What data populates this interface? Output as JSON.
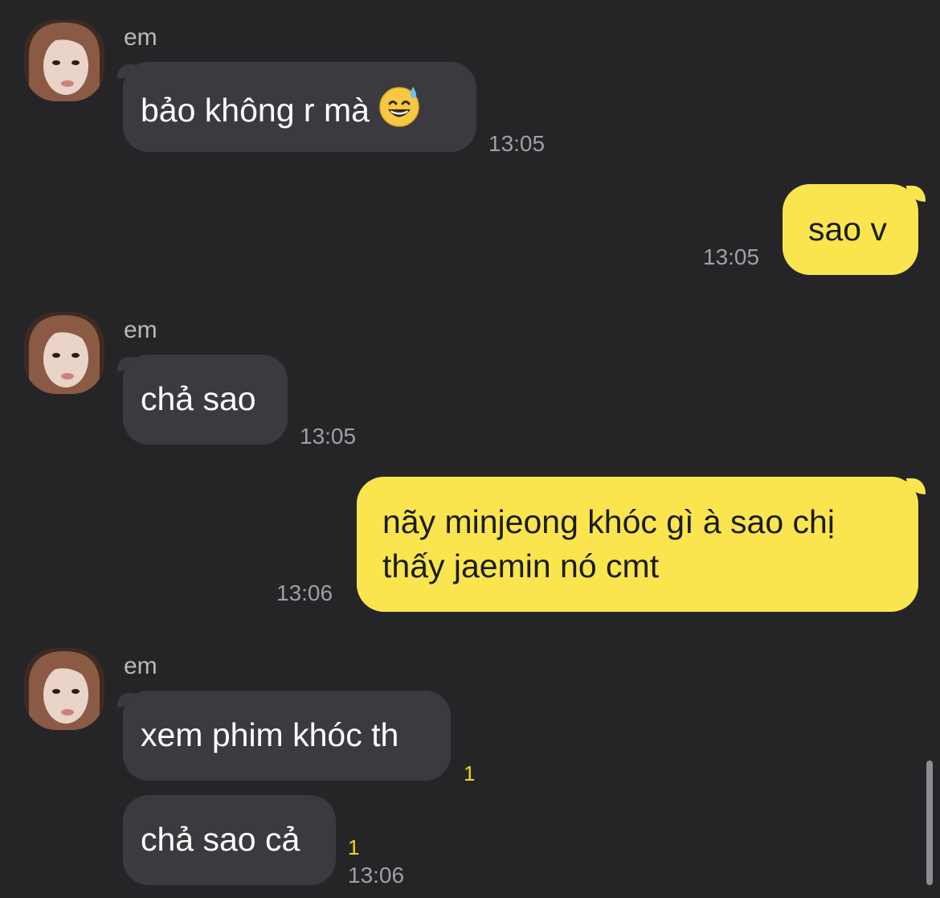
{
  "sender_name": "em",
  "messages": [
    {
      "side": "in",
      "text": "bảo không r mà",
      "emoji": "grinning-face-with-sweat",
      "time": "13:05"
    },
    {
      "side": "out",
      "text": "sao v",
      "time": "13:05"
    },
    {
      "side": "in",
      "text": "chả sao",
      "time": "13:05"
    },
    {
      "side": "out",
      "lines": [
        "nãy minjeong khóc gì à sao chị",
        "thấy jaemin nó cmt"
      ],
      "time": "13:06"
    },
    {
      "side": "in",
      "text": "xem phim khóc th",
      "unread": "1"
    },
    {
      "side": "in",
      "text": "chả sao cả",
      "unread": "1",
      "time": "13:06"
    }
  ],
  "colors": {
    "background": "#252528",
    "incoming_bubble": "#3b3b3f",
    "outgoing_bubble": "#fae54f",
    "unread_count": "#f4d70f"
  }
}
